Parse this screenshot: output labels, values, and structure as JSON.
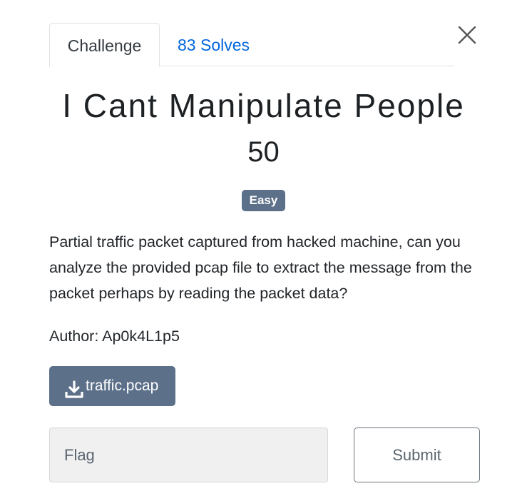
{
  "tabs": {
    "challenge_label": "Challenge",
    "solves_label": "83 Solves"
  },
  "icons": {
    "close": "close-icon",
    "download": "download-icon"
  },
  "challenge": {
    "name": "I Cant Manipulate People",
    "points": "50",
    "difficulty": "Easy",
    "description": "Partial traffic packet captured from hacked machine, can you analyze the provided pcap file to extract the message from the packet perhaps by reading the packet data?",
    "author": "Author: Ap0k4L1p5",
    "file_name": "traffic.pcap"
  },
  "flag_form": {
    "placeholder": "Flag",
    "value": "",
    "submit_label": "Submit"
  },
  "colors": {
    "accent": "#5c7089",
    "link": "#0066dd"
  }
}
